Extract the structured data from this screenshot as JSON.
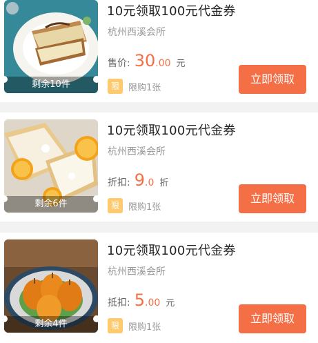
{
  "items": [
    {
      "title": "10元领取100元代金券",
      "store": "杭州西溪会所",
      "price_label": "售价:",
      "price_int": "30",
      "price_dec": ".00",
      "unit": "元",
      "limit_tag": "限",
      "limit_text": "限购1张",
      "stock": "剩余10件",
      "button": "立即领取"
    },
    {
      "title": "10元领取100元代金券",
      "store": "杭州西溪会所",
      "price_label": "折扣:",
      "price_int": "9",
      "price_dec": ".0",
      "unit": "折",
      "limit_tag": "限",
      "limit_text": "限购1张",
      "stock": "剩余6件",
      "button": "立即领取"
    },
    {
      "title": "10元领取100元代金券",
      "store": "杭州西溪会所",
      "price_label": "抵扣:",
      "price_int": "5",
      "price_dec": ".00",
      "unit": "元",
      "limit_tag": "限",
      "limit_text": "限购1张",
      "stock": "剩余4件",
      "button": "立即领取"
    }
  ],
  "colors": {
    "accent": "#f46f45",
    "limit_tag": "#ffc96e",
    "background": "#f2f2f2"
  }
}
